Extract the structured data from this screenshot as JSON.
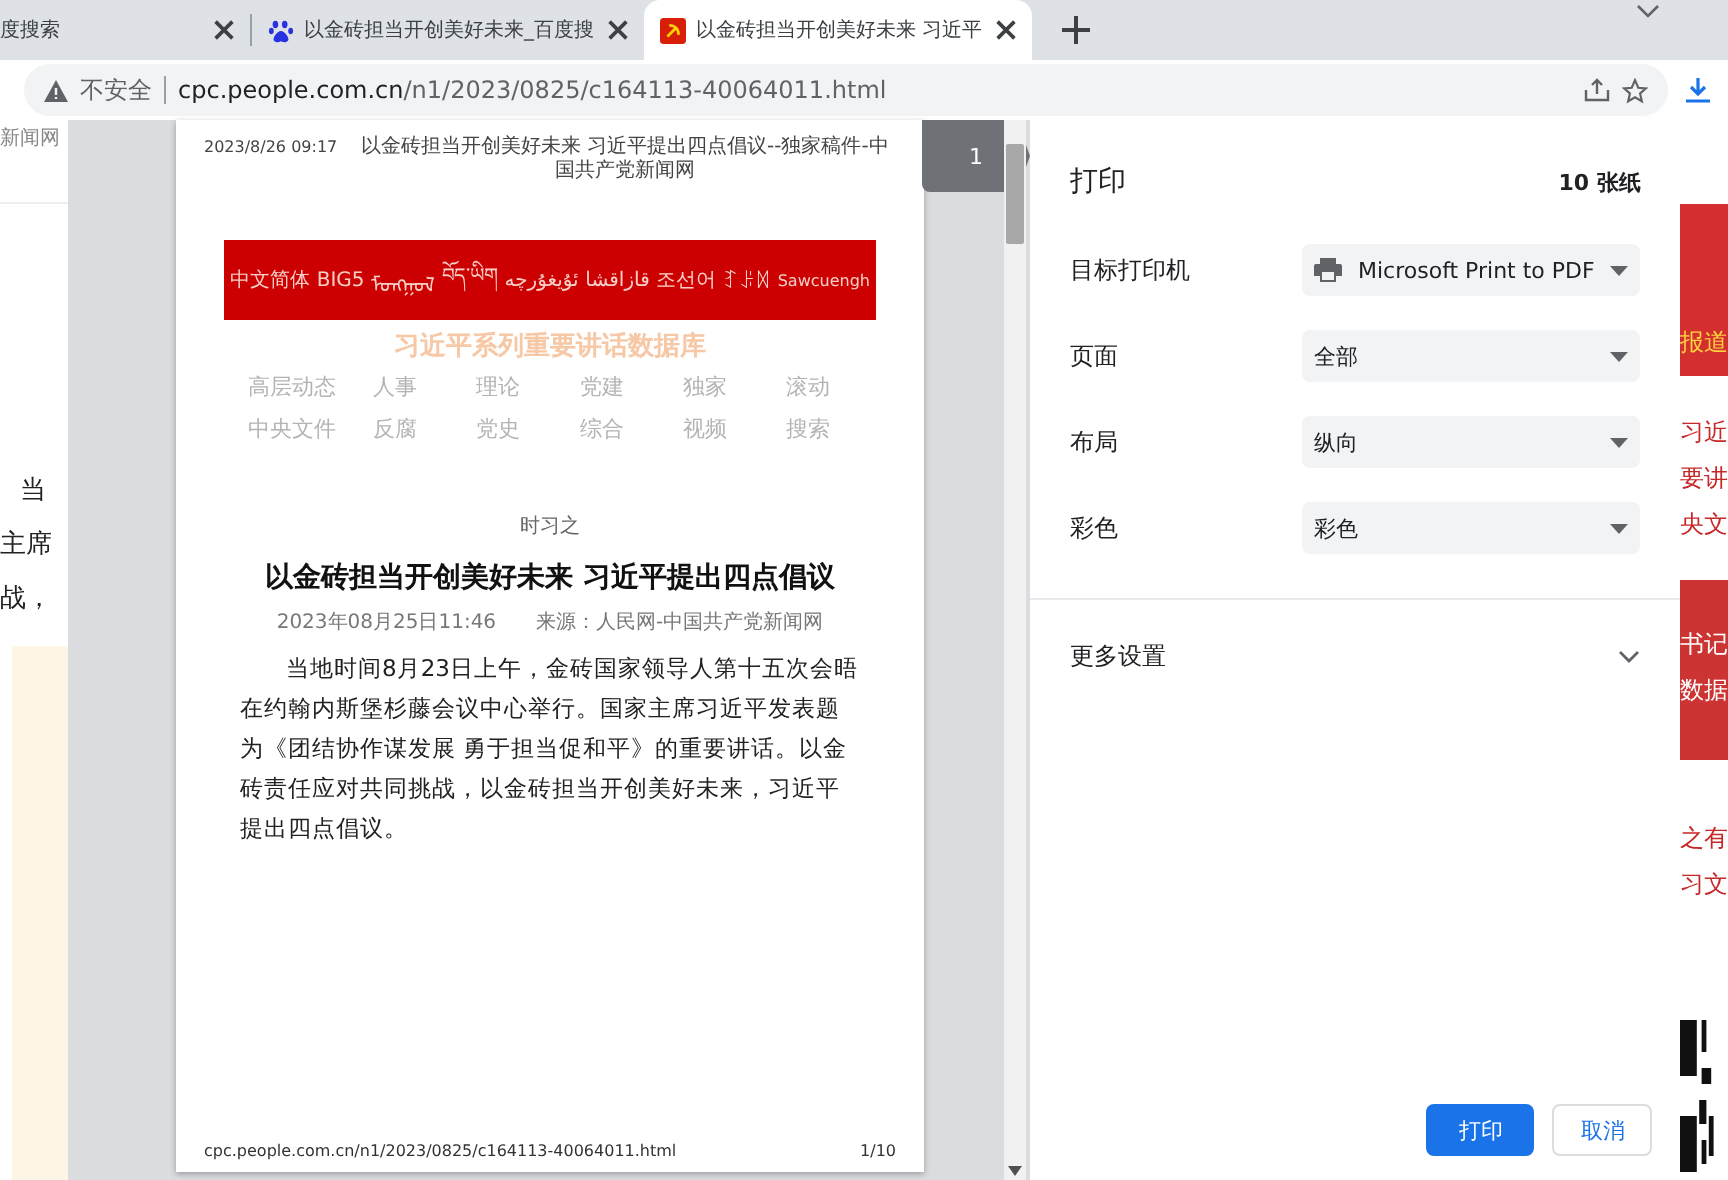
{
  "tabs": [
    {
      "title": "度搜索",
      "selected": false
    },
    {
      "title": "以金砖担当开创美好未来_百度搜",
      "kind": "paw",
      "selected": false
    },
    {
      "title": "以金砖担当开创美好未来 习近平",
      "kind": "emblem",
      "selected": true
    }
  ],
  "address_bar": {
    "security": "不安全",
    "host": "cpc.people.com.cn",
    "path": "/n1/2023/0825/c164113-40064011.html"
  },
  "background_page": {
    "site_name": "新闻网",
    "left_lines": [
      "当",
      "主席",
      "战，"
    ],
    "right_blocks": [
      {
        "kind": "banner",
        "texts": [
          "报道"
        ]
      },
      {
        "kind": "links",
        "texts": [
          "习近",
          "要讲",
          "央文"
        ]
      },
      {
        "kind": "dark",
        "texts": [
          "书记",
          "数据"
        ]
      },
      {
        "kind": "links",
        "texts": [
          "之有",
          "习文"
        ]
      }
    ]
  },
  "print_preview": {
    "page_number": "1",
    "page": {
      "header_date": "2023/8/26 09:17",
      "header_title": "以金砖担当开创美好未来 习近平提出四点倡议--独家稿件-中国共产党新闻网",
      "languages": [
        "中文简体",
        "BIG5",
        "ᠮᠣᠩᠭᠣᠯ",
        "བོད་ཡིག",
        "ئۇيغۇرچە",
        "قازاقشا",
        "조선어",
        "ꆈꌠꉙ",
        "Sawcuengh"
      ],
      "site_heading": "习近平系列重要讲话数据库",
      "nav": [
        "高层动态",
        "人事",
        "理论",
        "党建",
        "独家",
        "滚动",
        "中央文件",
        "反腐",
        "党史",
        "综合",
        "视频",
        "搜索"
      ],
      "author": "时习之",
      "title": "以金砖担当开创美好未来 习近平提出四点倡议",
      "meta": "2023年08月25日11:46　　来源：人民网-中国共产党新闻网",
      "body": "当地时间8月23日上午，金砖国家领导人第十五次会晤在约翰内斯堡杉藤会议中心举行。国家主席习近平发表题为《团结协作谋发展 勇于担当促和平》的重要讲话。以金砖责任应对共同挑战，以金砖担当开创美好未来，习近平提出四点倡议。",
      "footer_url": "cpc.people.com.cn/n1/2023/0825/c164113-40064011.html",
      "footer_page": "1/10"
    }
  },
  "print_settings": {
    "title": "打印",
    "sheets": "10 张纸",
    "options": [
      {
        "label": "目标打印机",
        "value": "Microsoft Print to PDF",
        "kind": "printer"
      },
      {
        "label": "页面",
        "value": "全部",
        "kind": "plain"
      },
      {
        "label": "布局",
        "value": "纵向",
        "kind": "plain"
      },
      {
        "label": "彩色",
        "value": "彩色",
        "kind": "plain"
      }
    ],
    "more": {
      "label": "更多设置",
      "expanded": false
    },
    "buttons": [
      {
        "label": "打印",
        "kind": "primary"
      },
      {
        "label": "取消",
        "kind": "secondary"
      }
    ]
  }
}
